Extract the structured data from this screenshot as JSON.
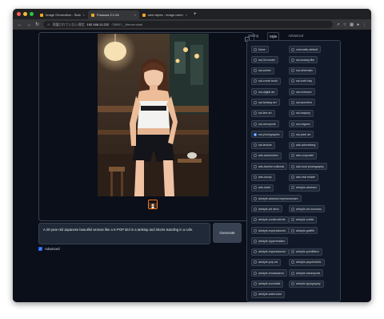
{
  "browser": {
    "traffic_colors": [
      "#ff5f57",
      "#febc2e",
      "#28c840"
    ],
    "tabs": [
      {
        "title": "Image Generation - Stable Diffusi",
        "active": false
      },
      {
        "title": "Fooocus 2.1.24",
        "active": true
      },
      {
        "title": "sdxl-styles - image-harmonizer",
        "active": false
      }
    ],
    "new_tab": "+",
    "url_prefix": "保護されていない通信",
    "url_host": "192.168.11.222",
    "url_path": ":7860/?__theme=dark"
  },
  "main": {
    "prompt": "A 20-year-old Japanese beautiful woman like a K-POP idol in a tanktop and shorts standing in a cafe.",
    "generate_label": "Generate",
    "advanced_label": "Advanced",
    "advanced_checked": true
  },
  "settings_tabs": [
    "Setting",
    "Style",
    "Advanced"
  ],
  "styles": [
    [
      {
        "label": "None",
        "checked": false
      },
      {
        "label": "cinematic-default",
        "checked": false
      }
    ],
    [
      {
        "label": "sai-3d-model",
        "checked": false
      },
      {
        "label": "sai-analog film",
        "checked": false
      }
    ],
    [
      {
        "label": "sai-anime",
        "checked": false
      },
      {
        "label": "sai-cinematic",
        "checked": false
      }
    ],
    [
      {
        "label": "sai-comic book",
        "checked": false
      },
      {
        "label": "sai-craft clay",
        "checked": false
      }
    ],
    [
      {
        "label": "sai-digital art",
        "checked": false
      },
      {
        "label": "sai-enhance",
        "checked": false
      }
    ],
    [
      {
        "label": "sai-fantasy art",
        "checked": false
      },
      {
        "label": "sai-isometric",
        "checked": false
      }
    ],
    [
      {
        "label": "sai-line art",
        "checked": false
      },
      {
        "label": "sai-lowpoly",
        "checked": false
      }
    ],
    [
      {
        "label": "sai-neonpunk",
        "checked": false
      },
      {
        "label": "sai-origami",
        "checked": false
      }
    ],
    [
      {
        "label": "sai-photographic",
        "checked": true
      },
      {
        "label": "sai-pixel art",
        "checked": false
      }
    ],
    [
      {
        "label": "sai-texture",
        "checked": false
      },
      {
        "label": "ads-advertising",
        "checked": false
      }
    ],
    [
      {
        "label": "ads-automotive",
        "checked": false
      },
      {
        "label": "ads-corporate",
        "checked": false
      }
    ],
    [
      {
        "label": "ads-fashion editorial",
        "checked": false
      },
      {
        "label": "ads-food photography",
        "checked": false
      }
    ],
    [
      {
        "label": "ads-luxury",
        "checked": false
      },
      {
        "label": "ads-real estate",
        "checked": false
      }
    ],
    [
      {
        "label": "ads-retail",
        "checked": false
      },
      {
        "label": "artstyle-abstract",
        "checked": false
      }
    ],
    [
      {
        "label": "artstyle-abstract expressionism",
        "checked": false
      }
    ],
    [
      {
        "label": "artstyle-art deco",
        "checked": false
      },
      {
        "label": "artstyle-art nouveau",
        "checked": false
      }
    ],
    [
      {
        "label": "artstyle-constructivist",
        "checked": false
      },
      {
        "label": "artstyle-cubist",
        "checked": false
      }
    ],
    [
      {
        "label": "artstyle-expressionist",
        "checked": false
      },
      {
        "label": "artstyle-graffiti",
        "checked": false
      }
    ],
    [
      {
        "label": "artstyle-hyperrealism",
        "checked": false
      }
    ],
    [
      {
        "label": "artstyle-impressionist",
        "checked": false
      },
      {
        "label": "artstyle-pointillism",
        "checked": false
      }
    ],
    [
      {
        "label": "artstyle-pop art",
        "checked": false
      },
      {
        "label": "artstyle-psychedelic",
        "checked": false
      }
    ],
    [
      {
        "label": "artstyle-renaissance",
        "checked": false
      },
      {
        "label": "artstyle-steampunk",
        "checked": false
      }
    ],
    [
      {
        "label": "artstyle-surrealist",
        "checked": false
      },
      {
        "label": "artstyle-typography",
        "checked": false
      }
    ],
    [
      {
        "label": "artstyle-watercolor",
        "checked": false
      }
    ]
  ]
}
